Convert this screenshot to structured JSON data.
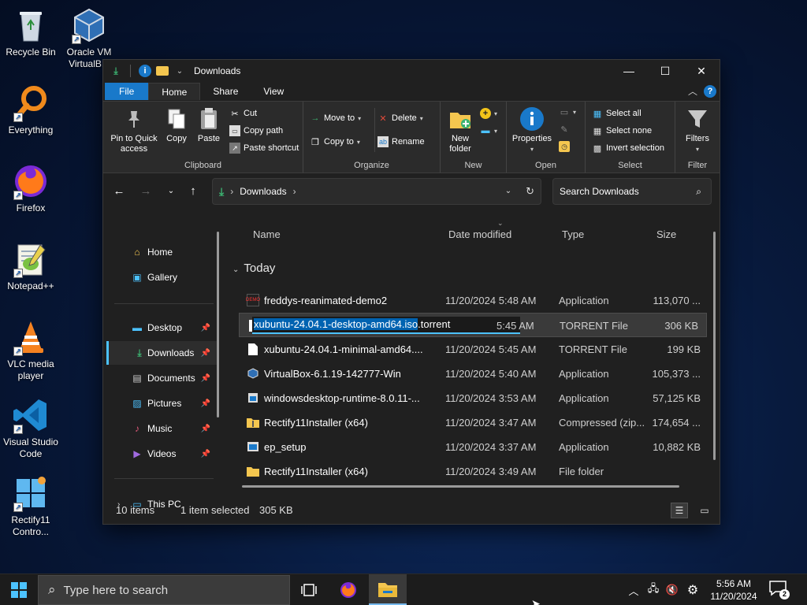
{
  "desktop": {
    "icons": [
      {
        "label": "Recycle Bin"
      },
      {
        "label": "Oracle VM VirtualB..."
      },
      {
        "label": "Everything"
      },
      {
        "label": "Firefox"
      },
      {
        "label": "Notepad++"
      },
      {
        "label": "VLC media player"
      },
      {
        "label": "Visual Studio Code"
      },
      {
        "label": "Rectify11 Contro..."
      }
    ]
  },
  "window": {
    "title": "Downloads",
    "controls": {
      "minimize": "—",
      "maximize": "☐",
      "close": "✕"
    }
  },
  "ribbon": {
    "tabs": [
      "File",
      "Home",
      "Share",
      "View"
    ],
    "active_tab": "Home",
    "clipboard": {
      "pin_label": "Pin to Quick access",
      "copy_label": "Copy",
      "paste_label": "Paste",
      "cut_label": "Cut",
      "copy_path_label": "Copy path",
      "paste_shortcut_label": "Paste shortcut",
      "group_label": "Clipboard"
    },
    "organize": {
      "move_to_label": "Move to",
      "copy_to_label": "Copy to",
      "delete_label": "Delete",
      "rename_label": "Rename",
      "group_label": "Organize"
    },
    "new": {
      "new_folder_label": "New folder",
      "group_label": "New"
    },
    "open": {
      "properties_label": "Properties",
      "group_label": "Open"
    },
    "select": {
      "select_all_label": "Select all",
      "select_none_label": "Select none",
      "invert_label": "Invert selection",
      "group_label": "Select"
    },
    "filter": {
      "filters_label": "Filters",
      "group_label": "Filter"
    }
  },
  "address": {
    "path": "Downloads",
    "separator": "›",
    "search_placeholder": "Search Downloads"
  },
  "nav": {
    "items": [
      {
        "label": "Home"
      },
      {
        "label": "Gallery"
      },
      {
        "label": "Desktop"
      },
      {
        "label": "Downloads"
      },
      {
        "label": "Documents"
      },
      {
        "label": "Pictures"
      },
      {
        "label": "Music"
      },
      {
        "label": "Videos"
      },
      {
        "label": "This PC"
      }
    ],
    "selected": "Downloads"
  },
  "filelist": {
    "columns": [
      "Name",
      "Date modified",
      "Type",
      "Size"
    ],
    "group": "Today",
    "rows": [
      {
        "name": "freddys-reanimated-demo2",
        "date": "11/20/2024 5:48 AM",
        "type": "Application",
        "size": "113,070 ...",
        "icon": "app-icon"
      },
      {
        "name": "xubuntu-24.04.1-desktop-amd64.iso.torrent",
        "name_selected": "xubuntu-24.04.1-desktop-amd64.iso",
        "name_rest": ".torrent",
        "date": "5:45 AM",
        "type": "TORRENT File",
        "size": "306 KB",
        "icon": "file-icon",
        "renaming": true
      },
      {
        "name": "xubuntu-24.04.1-minimal-amd64....",
        "date": "11/20/2024 5:45 AM",
        "type": "TORRENT File",
        "size": "199 KB",
        "icon": "file-icon"
      },
      {
        "name": "VirtualBox-6.1.19-142777-Win",
        "date": "11/20/2024 5:40 AM",
        "type": "Application",
        "size": "105,373 ...",
        "icon": "virtualbox-icon"
      },
      {
        "name": "windowsdesktop-runtime-8.0.11-...",
        "date": "11/20/2024 3:53 AM",
        "type": "Application",
        "size": "57,125 KB",
        "icon": "installer-icon"
      },
      {
        "name": "Rectify11Installer (x64)",
        "date": "11/20/2024 3:47 AM",
        "type": "Compressed (zip...",
        "size": "174,654 ...",
        "icon": "zip-folder-icon"
      },
      {
        "name": "ep_setup",
        "date": "11/20/2024 3:37 AM",
        "type": "Application",
        "size": "10,882 KB",
        "icon": "app-icon"
      },
      {
        "name": "Rectify11Installer (x64)",
        "date": "11/20/2024 3:49 AM",
        "type": "File folder",
        "size": "",
        "icon": "folder-icon"
      }
    ]
  },
  "status": {
    "item_count": "10 items",
    "selection": "1 item selected",
    "selection_size": "305 KB"
  },
  "taskbar": {
    "search_placeholder": "Type here to search",
    "time": "5:56 AM",
    "date": "11/20/2024",
    "notification_count": "2"
  },
  "colors": {
    "accent": "#1979ca",
    "selection_highlight": "#0063b1",
    "nav_indicator": "#4cc2ff"
  }
}
